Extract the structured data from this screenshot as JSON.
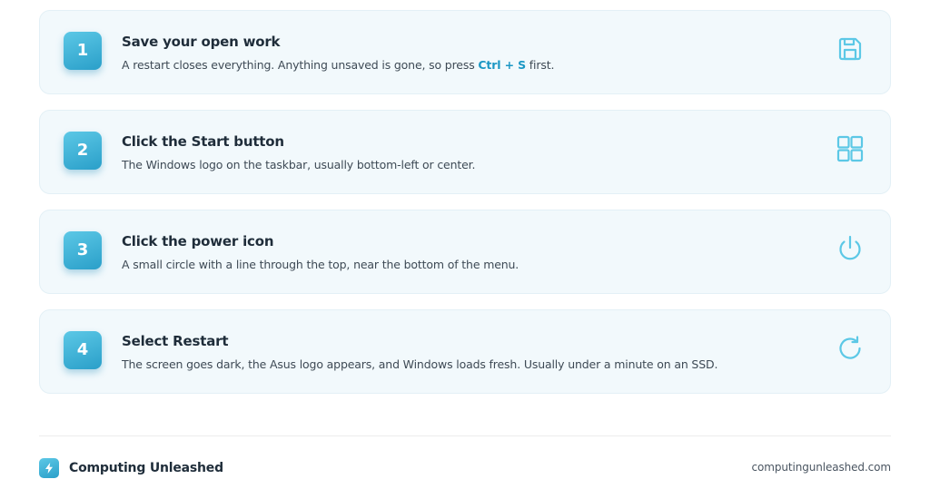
{
  "accent_color": "#2a9fc9",
  "icon_color": "#5cc8e6",
  "steps": [
    {
      "number": "1",
      "title": "Save your open work",
      "desc_before": "A restart closes everything. Anything unsaved is gone, so press ",
      "desc_key": "Ctrl + S",
      "desc_after": " first.",
      "icon": "save-icon"
    },
    {
      "number": "2",
      "title": "Click the Start button",
      "desc": "The Windows logo on the taskbar, usually bottom-left or center.",
      "icon": "windows-start-icon"
    },
    {
      "number": "3",
      "title": "Click the power icon",
      "desc": "A small circle with a line through the top, near the bottom of the menu.",
      "icon": "power-icon"
    },
    {
      "number": "4",
      "title": "Select Restart",
      "desc": "The screen goes dark, the Asus logo appears, and Windows loads fresh. Usually under a minute on an SSD.",
      "icon": "restart-icon"
    }
  ],
  "footer": {
    "brand_name": "Computing Unleashed",
    "brand_icon": "lightning-bolt-icon",
    "site_url": "computingunleashed.com"
  }
}
